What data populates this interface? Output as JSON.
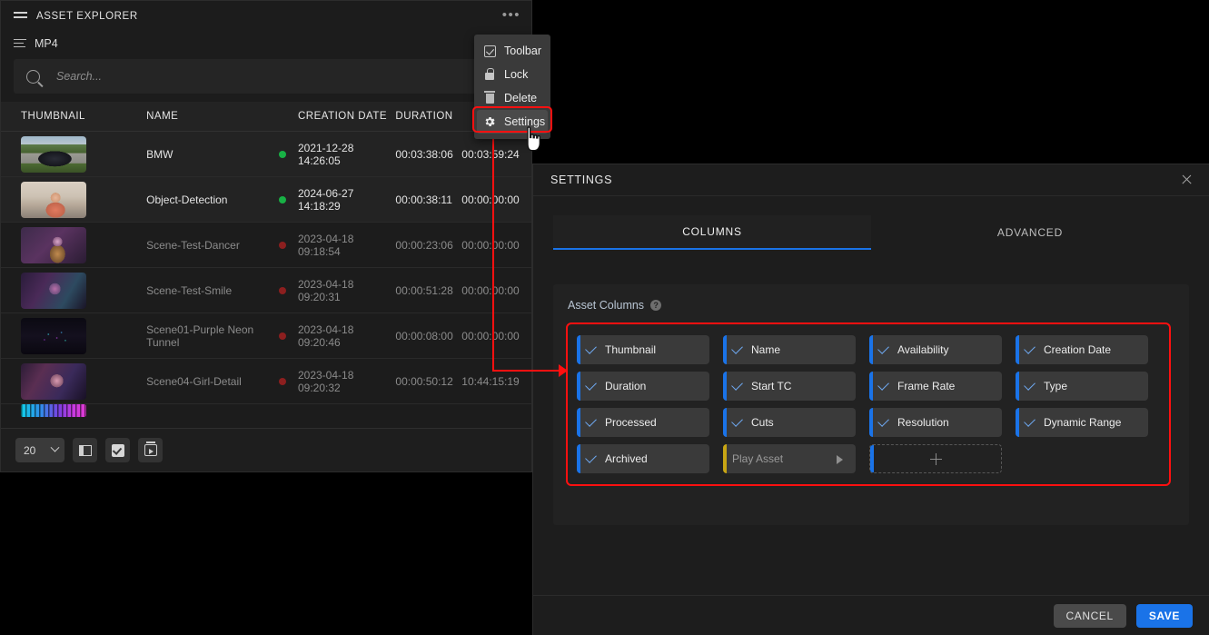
{
  "explorer": {
    "title": "ASSET EXPLORER",
    "menu_icon": "hamburger-icon",
    "more_icon": "more-options-icon",
    "filter_label": "MP4",
    "search": {
      "placeholder": "Search...",
      "value": "",
      "icon": "search-icon"
    },
    "columns": [
      "THUMBNAIL",
      "NAME",
      "CREATION DATE",
      "DURATION"
    ],
    "rows": [
      {
        "name": "BMW",
        "status": "green",
        "creation_date": "2021-12-28 14:26:05",
        "duration": "00:03:38:06",
        "start_tc": "00:03:59:24"
      },
      {
        "name": "Object-Detection",
        "status": "green",
        "creation_date": "2024-06-27 14:18:29",
        "duration": "00:00:38:11",
        "start_tc": "00:00:00:00"
      },
      {
        "name": "Scene-Test-Dancer",
        "status": "red",
        "creation_date": "2023-04-18 09:18:54",
        "duration": "00:00:23:06",
        "start_tc": "00:00:00:00"
      },
      {
        "name": "Scene-Test-Smile",
        "status": "red",
        "creation_date": "2023-04-18 09:20:31",
        "duration": "00:00:51:28",
        "start_tc": "00:00:00:00"
      },
      {
        "name": "Scene01-Purple Neon Tunnel",
        "status": "red",
        "creation_date": "2023-04-18 09:20:46",
        "duration": "00:00:08:00",
        "start_tc": "00:00:00:00"
      },
      {
        "name": "Scene04-Girl-Detail",
        "status": "red",
        "creation_date": "2023-04-18 09:20:32",
        "duration": "00:00:50:12",
        "start_tc": "10:44:15:19"
      }
    ],
    "footer": {
      "page_size": "20",
      "chevron_icon": "chevron-down-icon",
      "panel_icon": "panel-toggle-icon",
      "select_icon": "select-all-checkbox-icon",
      "archive_icon": "archive-player-icon"
    }
  },
  "context_menu": {
    "items": [
      {
        "label": "Toolbar",
        "icon": "checkbox-checked-icon"
      },
      {
        "label": "Lock",
        "icon": "lock-icon"
      },
      {
        "label": "Delete",
        "icon": "trash-icon"
      },
      {
        "label": "Settings",
        "icon": "gear-icon"
      }
    ]
  },
  "settings": {
    "title": "SETTINGS",
    "close_icon": "close-icon",
    "tabs": [
      {
        "label": "COLUMNS",
        "active": true
      },
      {
        "label": "ADVANCED",
        "active": false
      }
    ],
    "section_label": "Asset Columns",
    "help_icon": "help-icon",
    "help_glyph": "?",
    "chips": [
      {
        "label": "Thumbnail",
        "state": "checked"
      },
      {
        "label": "Name",
        "state": "checked"
      },
      {
        "label": "Availability",
        "state": "checked"
      },
      {
        "label": "Creation Date",
        "state": "checked"
      },
      {
        "label": "Duration",
        "state": "checked"
      },
      {
        "label": "Start TC",
        "state": "checked"
      },
      {
        "label": "Frame Rate",
        "state": "checked"
      },
      {
        "label": "Type",
        "state": "checked"
      },
      {
        "label": "Processed",
        "state": "checked"
      },
      {
        "label": "Cuts",
        "state": "checked"
      },
      {
        "label": "Resolution",
        "state": "checked"
      },
      {
        "label": "Dynamic Range",
        "state": "checked"
      },
      {
        "label": "Archived",
        "state": "checked"
      },
      {
        "label": "Play Asset",
        "state": "expandable"
      }
    ],
    "add_icon": "add-column-icon",
    "cancel_label": "CANCEL",
    "save_label": "SAVE"
  },
  "colors": {
    "accent_blue": "#1a73e8",
    "highlight_red": "#ff1010",
    "status_online": "#18b145",
    "status_offline": "#8c1f1f",
    "play_asset_accent": "#c8a514"
  }
}
